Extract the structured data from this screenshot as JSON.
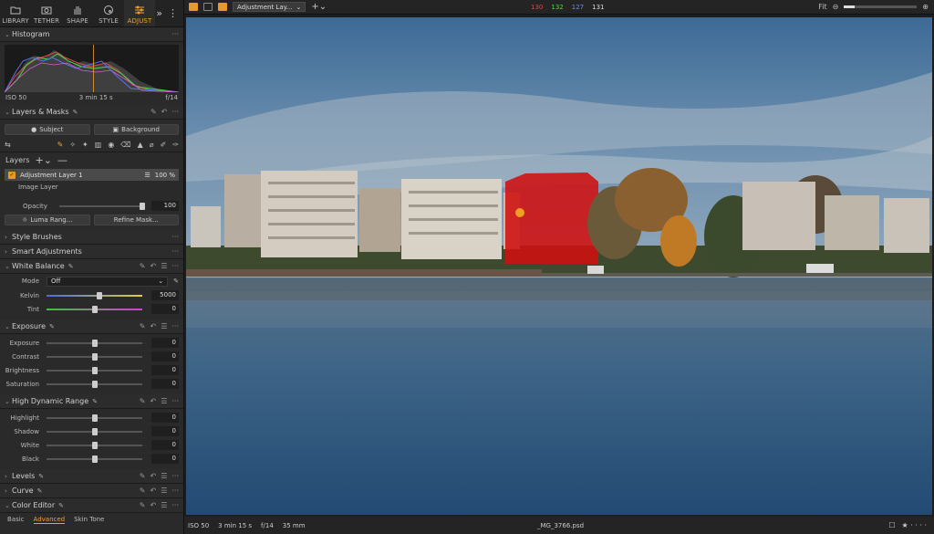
{
  "top_tabs": [
    {
      "label": "LIBRARY",
      "icon": "folder-icon",
      "active": false
    },
    {
      "label": "TETHER",
      "icon": "camera-icon",
      "active": false
    },
    {
      "label": "SHAPE",
      "icon": "hand-icon",
      "active": false
    },
    {
      "label": "STYLE",
      "icon": "palette-icon",
      "active": false
    },
    {
      "label": "ADJUST",
      "icon": "sliders-icon",
      "active": true
    }
  ],
  "histogram": {
    "title": "Histogram",
    "iso": "ISO 50",
    "shutter": "3 min 15 s",
    "aperture": "f/14"
  },
  "layers_masks": {
    "title": "Layers & Masks",
    "subject_label": "Subject",
    "background_label": "Background",
    "layers_label": "Layers",
    "layer_name": "Adjustment Layer 1",
    "layer_percent": "100 %",
    "sublayer": "Image Layer",
    "opacity_label": "Opacity",
    "opacity_value": "100",
    "opacity_level": 1.0,
    "luma_label": "Luma Rang...",
    "refine_label": "Refine Mask..."
  },
  "panels": {
    "style_brushes": "Style Brushes",
    "smart_adjustments": "Smart Adjustments",
    "levels": "Levels",
    "curve": "Curve",
    "color_editor": "Color Editor"
  },
  "white_balance": {
    "title": "White Balance",
    "mode_label": "Mode",
    "mode_value": "Off",
    "kelvin_label": "Kelvin",
    "kelvin_value": "5000",
    "kelvin_level": 0.55,
    "tint_label": "Tint",
    "tint_value": "0",
    "tint_level": 0.5
  },
  "exposure": {
    "title": "Exposure",
    "sliders": [
      {
        "label": "Exposure",
        "value": "0",
        "level": 0.5
      },
      {
        "label": "Contrast",
        "value": "0",
        "level": 0.5
      },
      {
        "label": "Brightness",
        "value": "0",
        "level": 0.5
      },
      {
        "label": "Saturation",
        "value": "0",
        "level": 0.5
      }
    ]
  },
  "hdr": {
    "title": "High Dynamic Range",
    "sliders": [
      {
        "label": "Highlight",
        "value": "0",
        "level": 0.5
      },
      {
        "label": "Shadow",
        "value": "0",
        "level": 0.5
      },
      {
        "label": "White",
        "value": "0",
        "level": 0.5
      },
      {
        "label": "Black",
        "value": "0",
        "level": 0.5
      }
    ]
  },
  "color_editor_tabs": [
    "Basic",
    "Advanced",
    "Skin Tone"
  ],
  "topbar": {
    "layer_select": "Adjustment Lay...",
    "rgb": {
      "r": "130",
      "g": "132",
      "b": "127",
      "l": "131"
    },
    "zoom": "Fit"
  },
  "status": {
    "iso": "ISO 50",
    "shutter": "3 min 15 s",
    "aperture": "f/14",
    "focal": "35 mm",
    "filename": "_MG_3766.psd",
    "rating": "★ · · · ·"
  },
  "colors": {
    "accent": "#f0a030",
    "mask": "#d01010",
    "r": "#e04848",
    "g": "#48d848",
    "b": "#5870f0"
  }
}
